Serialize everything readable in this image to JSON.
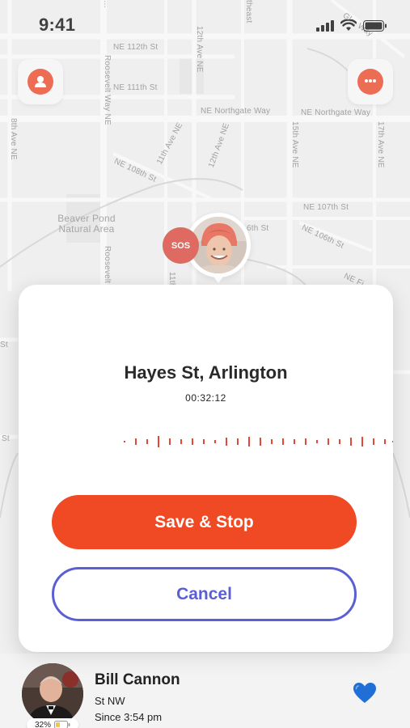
{
  "status_bar": {
    "time": "9:41"
  },
  "map": {
    "street_labels": [
      "NE 112th St",
      "NE 111th St",
      "NE Northgate Way",
      "NE Northgate Way",
      "NE 108th St",
      "NE 107th St",
      "NE 106th St",
      "6th St",
      "Roosevelt Way NE",
      "12th Ave NE",
      "8th Ave NE",
      "11th Ave NE",
      "12th Ave NE",
      "15th Ave NE",
      "17th Ave NE",
      "Roosevelt",
      "11th",
      "St",
      "St",
      "NE Fi",
      "theast",
      "Gl... Way"
    ],
    "park_label": "Beaver Pond Natural Area",
    "colors": {
      "background": "#ececec",
      "road": "#ffffff",
      "block": "#e0e0e0"
    }
  },
  "header": {
    "profile_icon": "person-icon",
    "chat_icon": "chat-bubble-icon"
  },
  "map_marker": {
    "sos_label": "SOS"
  },
  "modal": {
    "title": "Hayes St, Arlington",
    "timer": "00:32:12",
    "primary_button": "Save & Stop",
    "secondary_button": "Cancel",
    "colors": {
      "primary": "#ef4a24",
      "secondary": "#5b5fd4",
      "waveform": "#e8453a"
    }
  },
  "contact": {
    "name": "Bill Cannon",
    "line1": "St NW",
    "line2": "Since 3:54 pm",
    "battery": "32%",
    "favorite_icon": "blue-heart-icon"
  }
}
